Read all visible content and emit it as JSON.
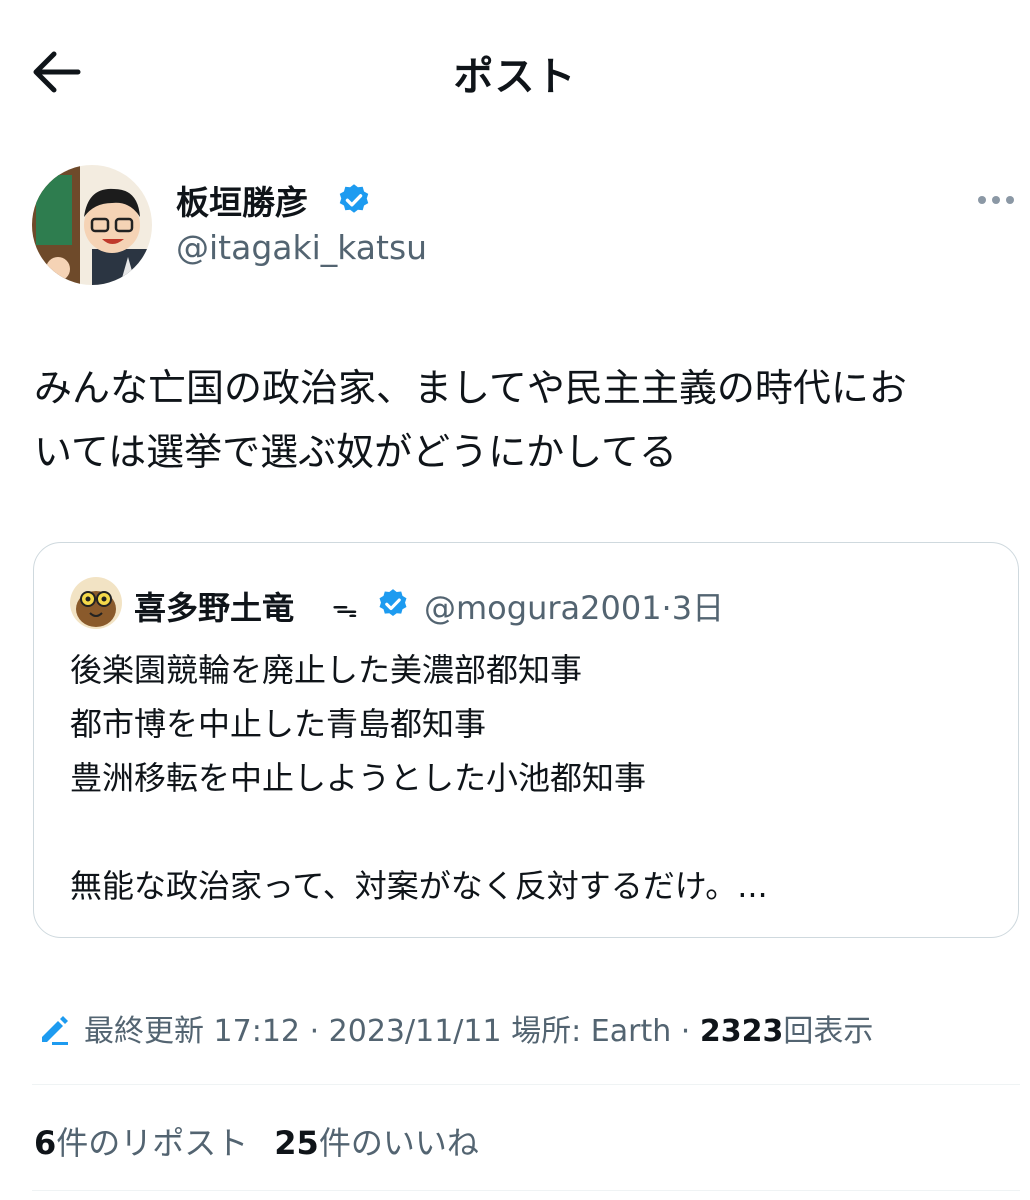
{
  "header": {
    "title": "ポスト",
    "back_icon": "arrow-left-icon"
  },
  "post": {
    "author": {
      "name": "板垣勝彦",
      "handle": "@itagaki_katsu",
      "verified": true
    },
    "text_line1": "みんな亡国の政治家、ましてや民主主義の時代にお",
    "text_line2": "いては選挙で選ぶ奴がどうにかしてる",
    "quoted": {
      "name": "喜多野土竜",
      "badge": "ᯓ",
      "handle": "@mogura2001",
      "dot": "·",
      "time": "3日",
      "body": "後楽園競輪を廃止した美濃部都知事\n都市博を中止した青島都知事\n豊洲移転を中止しようとした小池都知事\n\n無能な政治家って、対案がなく反対するだけ。..."
    },
    "meta": {
      "edited": "最終更新",
      "time": "17:12",
      "sep1": "·",
      "date": "2023/11/11",
      "location": "場所: Earth",
      "sep2": "·",
      "views": "2323",
      "views_label": "回表示"
    },
    "stats": {
      "reposts": "6",
      "reposts_label": "件のリポスト",
      "likes": "25",
      "likes_label": "件のいいね"
    }
  },
  "colors": {
    "accent": "#1d9bf0",
    "muted": "#536471",
    "text": "#0f1419",
    "border": "#cfd9de"
  }
}
